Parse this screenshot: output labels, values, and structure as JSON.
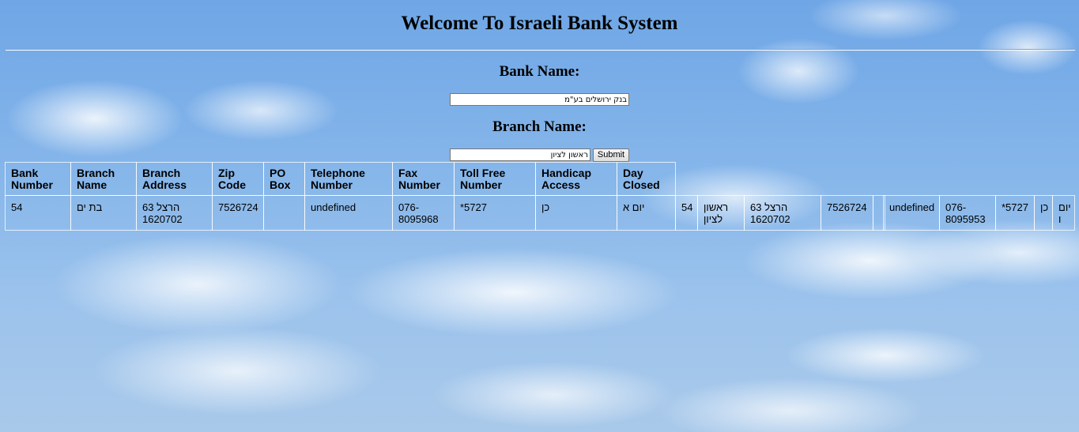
{
  "page": {
    "title": "Welcome To Israeli Bank System"
  },
  "form": {
    "bank_label": "Bank Name:",
    "bank_value": "בנק ירושלים בע\"מ",
    "branch_label": "Branch Name:",
    "branch_value": "ראשון לציון",
    "submit_label": "Submit"
  },
  "table": {
    "headers": [
      "Bank Number",
      "Branch Name",
      "Branch Address",
      "Zip Code",
      "PO Box",
      "Telephone Number",
      "Fax Number",
      "Toll Free Number",
      "Handicap Access",
      "Day Closed"
    ],
    "row1": [
      "54",
      "בת ים",
      "הרצל 63 1620702",
      "7526724",
      "",
      "undefined",
      "076-8095968",
      "*5727",
      "כן",
      "יום א"
    ],
    "row2": [
      "54",
      "ראשון לציון",
      "הרצל 63 1620702",
      "7526724",
      "",
      "undefined",
      "076-8095953",
      "*5727",
      "כן",
      "יום ו"
    ]
  }
}
